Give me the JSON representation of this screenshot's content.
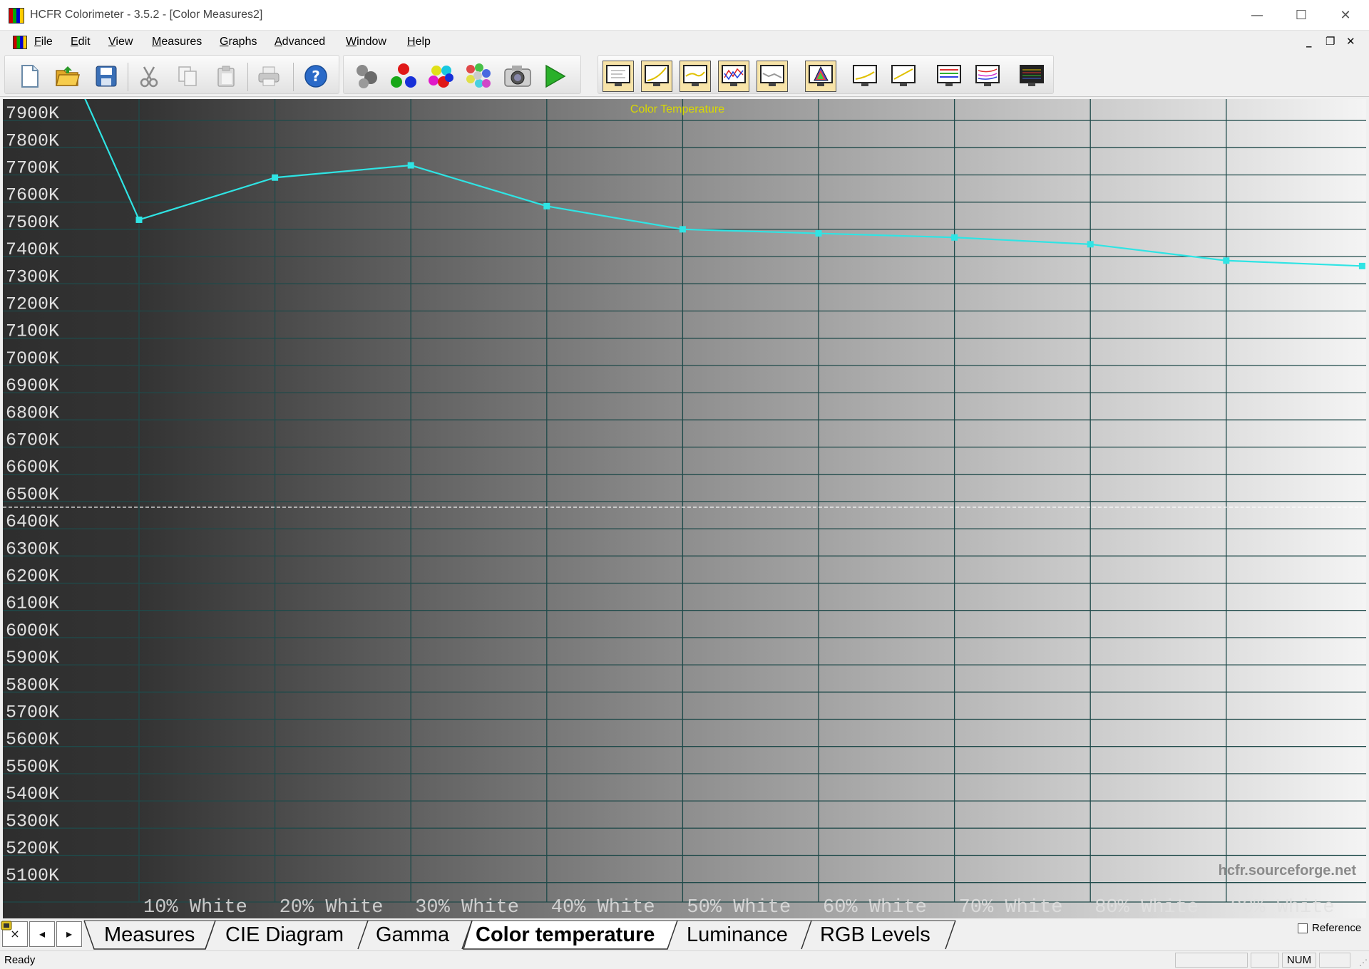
{
  "window": {
    "title": "HCFR Colorimeter - 3.5.2 - [Color Measures2]",
    "controls": [
      "minimize",
      "maximize",
      "close"
    ]
  },
  "menu": {
    "items": [
      "File",
      "Edit",
      "View",
      "Measures",
      "Graphs",
      "Advanced",
      "Window",
      "Help"
    ]
  },
  "toolbar": {
    "buttons": [
      "new-document-icon",
      "open-folder-icon",
      "save-icon",
      "cut-icon",
      "copy-icon",
      "paste-icon",
      "print-icon",
      "help-icon",
      "sensor-icon",
      "primaries-icon",
      "secondaries-icon",
      "saturations-icon",
      "camera-icon",
      "play-icon",
      "graph-view-1-icon",
      "graph-view-2-icon",
      "graph-view-3-icon",
      "graph-view-4-icon",
      "graph-view-5-icon",
      "cie-view-icon",
      "graph-view-7-icon",
      "graph-view-8-icon",
      "rgb-levels-icon",
      "multi-graph-icon",
      "gradient-graph-icon"
    ]
  },
  "chart_data": {
    "type": "line",
    "title": "Color Temperature",
    "watermark": "hcfr.sourceforge.net",
    "categories": [
      "10% White",
      "20% White",
      "30% White",
      "40% White",
      "50% White",
      "60% White",
      "70% White",
      "80% White",
      "90% White"
    ],
    "y_tick_labels": [
      "7900K",
      "7800K",
      "7700K",
      "7600K",
      "7500K",
      "7400K",
      "7300K",
      "7200K",
      "7100K",
      "7000K",
      "6900K",
      "6800K",
      "6700K",
      "6600K",
      "6500K",
      "6400K",
      "6300K",
      "6200K",
      "6100K",
      "6000K",
      "5900K",
      "5800K",
      "5700K",
      "5600K",
      "5500K",
      "5400K",
      "5300K",
      "5200K",
      "5100K"
    ],
    "ylim": [
      5000,
      7950
    ],
    "reference_line": 6500,
    "series": [
      {
        "x": [
          0,
          10,
          20,
          30,
          40,
          50,
          60,
          70,
          80,
          90,
          100
        ],
        "values": [
          8650,
          7530,
          7685,
          7730,
          7580,
          7495,
          7480,
          7465,
          7440,
          7380,
          7360
        ]
      }
    ],
    "colors": {
      "line": "#2fe4e4",
      "grid": "#1f4a4a",
      "title": "#d8d800",
      "axis_text": "#e0e0e0"
    }
  },
  "tabs": {
    "items": [
      "Measures",
      "CIE Diagram",
      "Gamma",
      "Color temperature",
      "Luminance",
      "RGB Levels"
    ],
    "active": "Color temperature",
    "nav": [
      "×",
      "◂",
      "▸"
    ],
    "reference_label": "Reference"
  },
  "status": {
    "text": "Ready",
    "num": "NUM"
  }
}
